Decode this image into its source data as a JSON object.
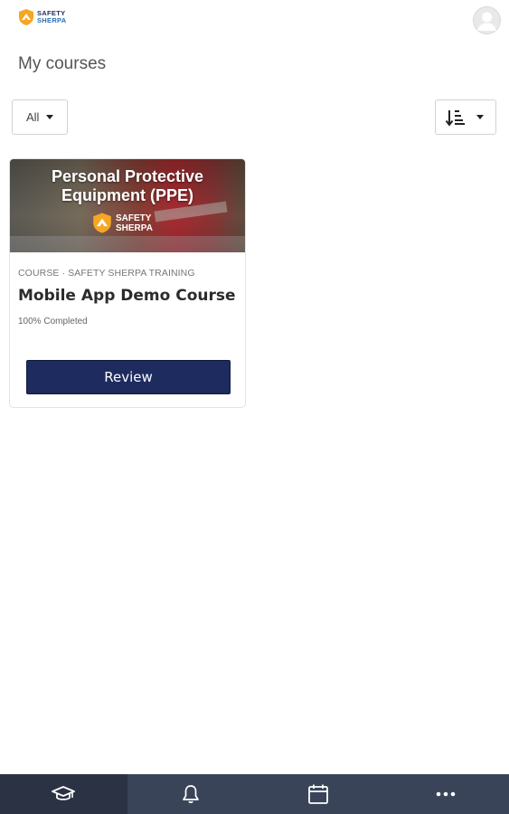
{
  "header": {
    "logo_line1": "SAFETY",
    "logo_line2": "SHERPA",
    "avatar_icon": "user-avatar-icon"
  },
  "page": {
    "title": "My courses"
  },
  "filters": {
    "selected": "All",
    "sort_icon": "sort-descending-icon"
  },
  "courses": [
    {
      "image_title_line1": "Personal Protective",
      "image_title_line2": "Equipment (PPE)",
      "image_logo_line1": "SAFETY",
      "image_logo_line2": "SHERPA",
      "meta": "COURSE · SAFETY SHERPA TRAINING",
      "name": "Mobile App Demo Course",
      "progress_text": "100% Completed",
      "progress_percent": 100,
      "action_label": "Review"
    }
  ],
  "bottom_nav": {
    "items": [
      {
        "icon": "graduation-cap-icon",
        "active": true
      },
      {
        "icon": "bell-icon",
        "active": false
      },
      {
        "icon": "calendar-icon",
        "active": false
      },
      {
        "icon": "more-icon",
        "active": false
      }
    ]
  },
  "colors": {
    "primary": "#1e2b5e",
    "nav_bg": "#3a4458",
    "nav_active": "#2b3243",
    "logo_orange": "#f5a623"
  }
}
